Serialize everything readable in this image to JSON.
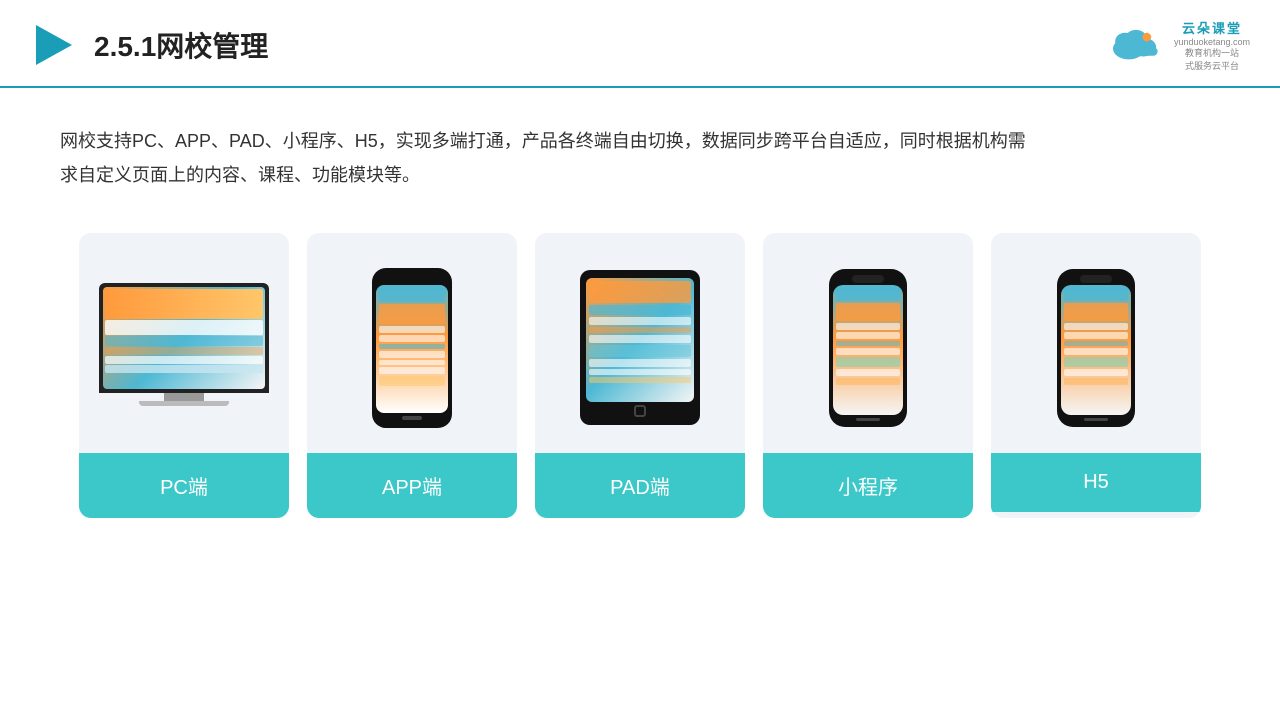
{
  "header": {
    "title": "2.5.1网校管理",
    "brand": {
      "name": "云朵课堂",
      "pinyin": "yunduoketang.com",
      "slogan": "教育机构一站\n式服务云平台"
    }
  },
  "description": {
    "text": "网校支持PC、APP、PAD、小程序、H5，实现多端打通，产品各终端自由切换，数据同步跨平台自适应，同时根据机构需求自定义页面上的内容、课程、功能模块等。"
  },
  "cards": [
    {
      "id": "pc",
      "label": "PC端",
      "type": "pc"
    },
    {
      "id": "app",
      "label": "APP端",
      "type": "phone"
    },
    {
      "id": "pad",
      "label": "PAD端",
      "type": "tablet"
    },
    {
      "id": "mini",
      "label": "小程序",
      "type": "phone-notch"
    },
    {
      "id": "h5",
      "label": "H5",
      "type": "phone-notch"
    }
  ],
  "colors": {
    "accent": "#3cc8c8",
    "header_line": "#1a9eb8",
    "text_main": "#333333",
    "card_bg": "#f0f4f8"
  }
}
